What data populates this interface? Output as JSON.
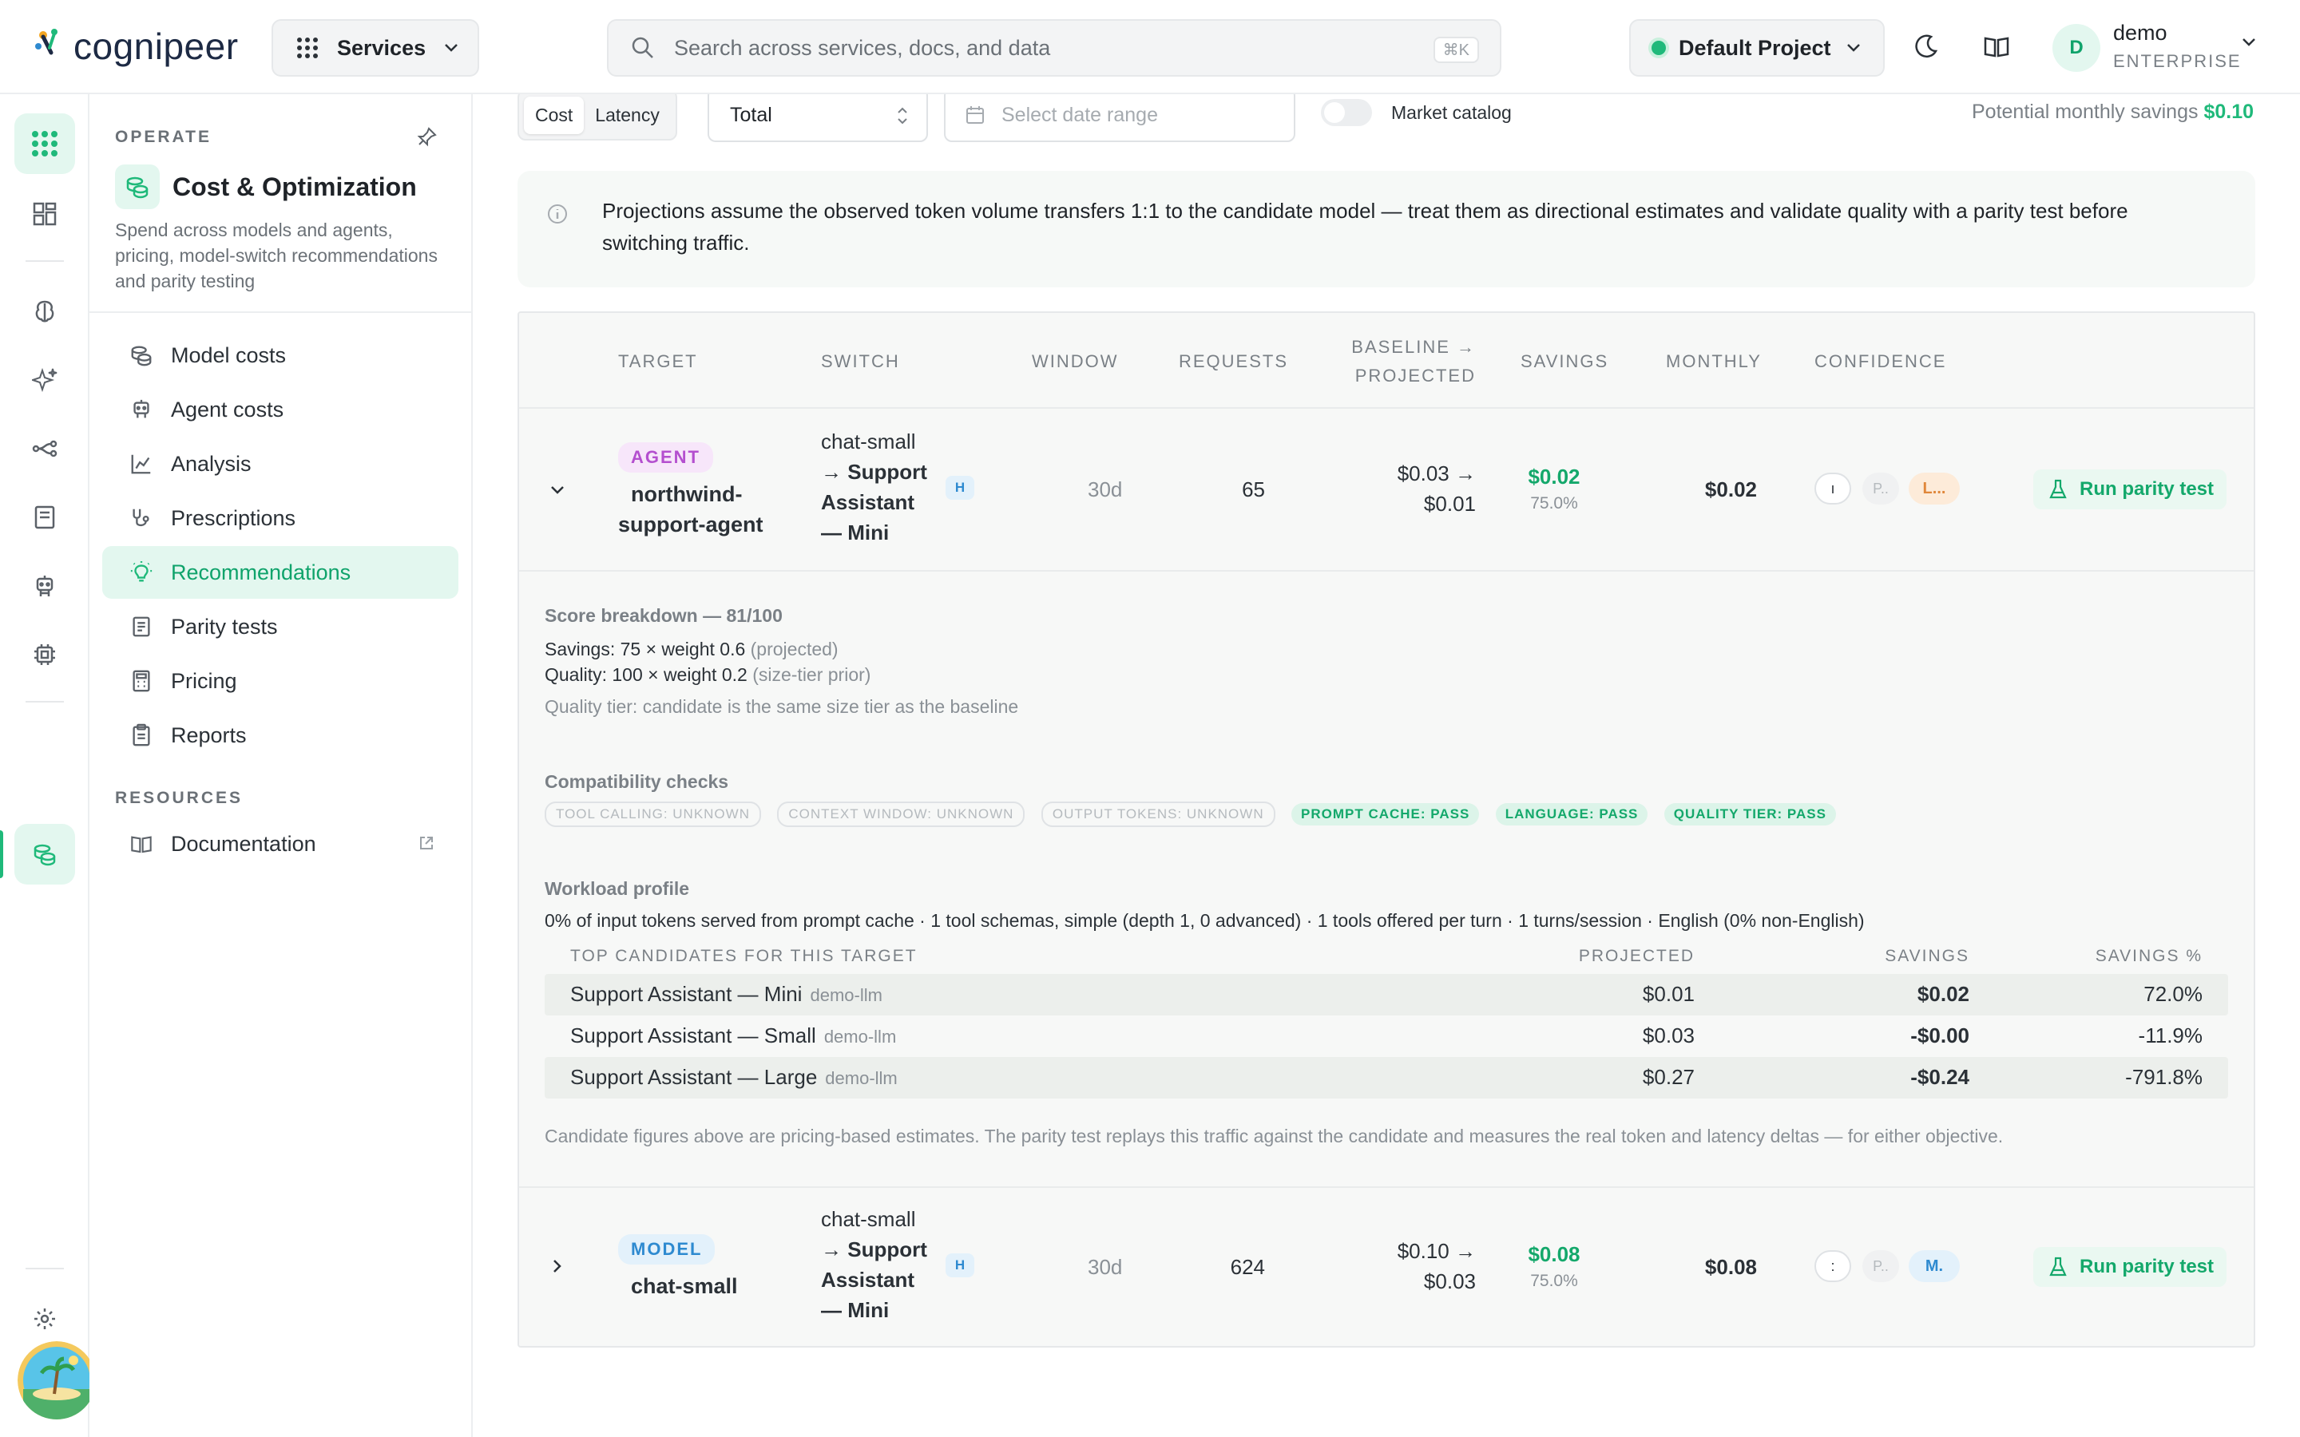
{
  "header": {
    "logo_text": "cognipeer",
    "services_label": "Services",
    "search_placeholder": "Search across services, docs, and data",
    "search_shortcut": "⌘K",
    "project_label": "Default Project",
    "user_initial": "D",
    "user_name": "demo",
    "user_plan": "ENTERPRISE"
  },
  "rail": {
    "icons": [
      "grid-icon",
      "dashboard-icon",
      "brain-icon",
      "sparkles-icon",
      "flow-icon",
      "book-icon",
      "agent-icon",
      "chip-icon",
      "coins-icon",
      "settings-icon"
    ]
  },
  "sidebar": {
    "section_operate": "OPERATE",
    "category_title": "Cost & Optimization",
    "category_desc": "Spend across models and agents, pricing, model-switch recommendations and parity testing",
    "items": [
      {
        "label": "Model costs",
        "icon": "coins-icon"
      },
      {
        "label": "Agent costs",
        "icon": "robot-icon"
      },
      {
        "label": "Analysis",
        "icon": "chart-icon"
      },
      {
        "label": "Prescriptions",
        "icon": "stethoscope-icon"
      },
      {
        "label": "Recommendations",
        "icon": "lightbulb-icon",
        "active": true
      },
      {
        "label": "Parity tests",
        "icon": "clipboard-icon"
      },
      {
        "label": "Pricing",
        "icon": "calculator-icon"
      },
      {
        "label": "Reports",
        "icon": "report-icon"
      }
    ],
    "section_resources": "RESOURCES",
    "documentation": "Documentation"
  },
  "toolbar": {
    "objective_options": [
      "Cost",
      "Latency"
    ],
    "objective_selected": "Cost",
    "aggregation": "Total",
    "date_placeholder": "Select date range",
    "market_catalog_label": "Market catalog",
    "market_catalog_on": false,
    "potential_label": "Potential monthly savings",
    "potential_value": "$0.10"
  },
  "notice": "Projections assume the observed token volume transfers 1:1 to the candidate model — treat them as directional estimates and validate quality with a parity test before switching traffic.",
  "table": {
    "headers": {
      "target": "TARGET",
      "switch": "SWITCH",
      "window": "WINDOW",
      "requests": "REQUESTS",
      "baseline_1": "BASELINE →",
      "baseline_2": "PROJECTED",
      "savings": "SAVINGS",
      "monthly": "MONTHLY",
      "confidence": "CONFIDENCE"
    },
    "rows": [
      {
        "kind": "AGENT",
        "name_1": "northwind-",
        "name_2": "support-agent",
        "switch_from": "chat-small",
        "switch_to_1": "→ Support",
        "switch_to_2": "Assistant",
        "switch_to_3": "— Mini",
        "tier_badge": "H",
        "window": "30d",
        "requests": "65",
        "baseline": "$0.03 →",
        "projected": "$0.01",
        "savings": "$0.02",
        "savings_pct": "75.0%",
        "monthly": "$0.02",
        "conf_1": "ı",
        "conf_2": "P..",
        "conf_3": "L...",
        "action": "Run parity test",
        "expanded": true
      },
      {
        "kind": "MODEL",
        "name_1": "chat-small",
        "name_2": "",
        "switch_from": "chat-small",
        "switch_to_1": "→ Support",
        "switch_to_2": "Assistant",
        "switch_to_3": "— Mini",
        "tier_badge": "H",
        "window": "30d",
        "requests": "624",
        "baseline": "$0.10 →",
        "projected": "$0.03",
        "savings": "$0.08",
        "savings_pct": "75.0%",
        "monthly": "$0.08",
        "conf_1": ":",
        "conf_2": "P..",
        "conf_3": "M.",
        "action": "Run parity test",
        "expanded": false
      }
    ],
    "detail": {
      "score_title": "Score breakdown — 81/100",
      "savings_line": "Savings: 75 × weight 0.6",
      "savings_note": "(projected)",
      "quality_line": "Quality: 100 × weight 0.2",
      "quality_note": "(size-tier prior)",
      "tier_note": "Quality tier: candidate is the same size tier as the baseline",
      "compat_title": "Compatibility checks",
      "checks": [
        {
          "label": "TOOL CALLING: UNKNOWN",
          "status": "unknown"
        },
        {
          "label": "CONTEXT WINDOW: UNKNOWN",
          "status": "unknown"
        },
        {
          "label": "OUTPUT TOKENS: UNKNOWN",
          "status": "unknown"
        },
        {
          "label": "PROMPT CACHE: PASS",
          "status": "pass"
        },
        {
          "label": "LANGUAGE: PASS",
          "status": "pass"
        },
        {
          "label": "QUALITY TIER: PASS",
          "status": "pass"
        }
      ],
      "workload_title": "Workload profile",
      "workload_text": "0% of input tokens served from prompt cache · 1 tool schemas, simple (depth 1, 0 advanced) · 1 tools offered per turn · 1 turns/session · English (0% non-English)",
      "cand_headers": {
        "name": "TOP CANDIDATES FOR THIS TARGET",
        "projected": "PROJECTED",
        "savings": "SAVINGS",
        "pct": "SAVINGS %"
      },
      "candidates": [
        {
          "name": "Support Assistant — Mini",
          "provider": "demo-llm",
          "projected": "$0.01",
          "savings": "$0.02",
          "pct": "72.0%",
          "positive": true
        },
        {
          "name": "Support Assistant — Small",
          "provider": "demo-llm",
          "projected": "$0.03",
          "savings": "-$0.00",
          "pct": "-11.9%",
          "positive": false
        },
        {
          "name": "Support Assistant — Large",
          "provider": "demo-llm",
          "projected": "$0.27",
          "savings": "-$0.24",
          "pct": "-791.8%",
          "positive": false
        }
      ],
      "footnote": "Candidate figures above are pricing-based estimates. The parity test replays this traffic against the candidate and measures the real token and latency deltas — for either objective."
    }
  },
  "colors": {
    "accent": "#1fb97a",
    "accent_text": "#14a86b",
    "negative": "#e0474e",
    "agent_pill": "#b44fcf",
    "model_pill": "#2e8ad0"
  }
}
